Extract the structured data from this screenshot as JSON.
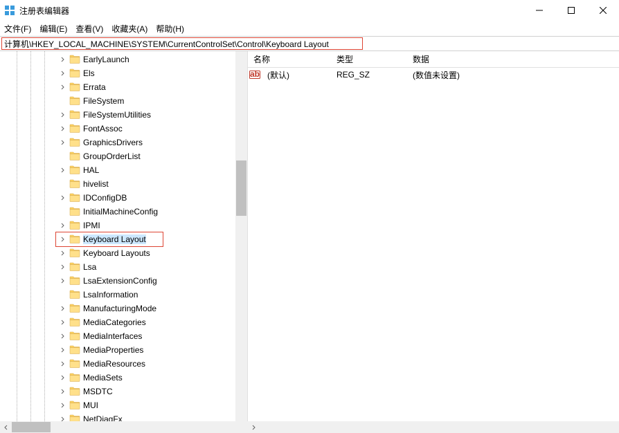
{
  "window": {
    "title": "注册表编辑器"
  },
  "menu": {
    "file": "文件(F)",
    "edit": "编辑(E)",
    "view": "查看(V)",
    "favorites": "收藏夹(A)",
    "help": "帮助(H)"
  },
  "address": {
    "path": "计算机\\HKEY_LOCAL_MACHINE\\SYSTEM\\CurrentControlSet\\Control\\Keyboard Layout"
  },
  "tree": {
    "items": [
      {
        "label": "EarlyLaunch",
        "expandable": true,
        "selected": false,
        "highlighted": false
      },
      {
        "label": "Els",
        "expandable": true,
        "selected": false,
        "highlighted": false
      },
      {
        "label": "Errata",
        "expandable": true,
        "selected": false,
        "highlighted": false
      },
      {
        "label": "FileSystem",
        "expandable": false,
        "selected": false,
        "highlighted": false
      },
      {
        "label": "FileSystemUtilities",
        "expandable": true,
        "selected": false,
        "highlighted": false
      },
      {
        "label": "FontAssoc",
        "expandable": true,
        "selected": false,
        "highlighted": false
      },
      {
        "label": "GraphicsDrivers",
        "expandable": true,
        "selected": false,
        "highlighted": false
      },
      {
        "label": "GroupOrderList",
        "expandable": false,
        "selected": false,
        "highlighted": false
      },
      {
        "label": "HAL",
        "expandable": true,
        "selected": false,
        "highlighted": false
      },
      {
        "label": "hivelist",
        "expandable": false,
        "selected": false,
        "highlighted": false
      },
      {
        "label": "IDConfigDB",
        "expandable": true,
        "selected": false,
        "highlighted": false
      },
      {
        "label": "InitialMachineConfig",
        "expandable": false,
        "selected": false,
        "highlighted": false
      },
      {
        "label": "IPMI",
        "expandable": true,
        "selected": false,
        "highlighted": false
      },
      {
        "label": "Keyboard Layout",
        "expandable": true,
        "selected": true,
        "highlighted": true
      },
      {
        "label": "Keyboard Layouts",
        "expandable": true,
        "selected": false,
        "highlighted": false
      },
      {
        "label": "Lsa",
        "expandable": true,
        "selected": false,
        "highlighted": false
      },
      {
        "label": "LsaExtensionConfig",
        "expandable": true,
        "selected": false,
        "highlighted": false
      },
      {
        "label": "LsaInformation",
        "expandable": false,
        "selected": false,
        "highlighted": false
      },
      {
        "label": "ManufacturingMode",
        "expandable": true,
        "selected": false,
        "highlighted": false
      },
      {
        "label": "MediaCategories",
        "expandable": true,
        "selected": false,
        "highlighted": false
      },
      {
        "label": "MediaInterfaces",
        "expandable": true,
        "selected": false,
        "highlighted": false
      },
      {
        "label": "MediaProperties",
        "expandable": true,
        "selected": false,
        "highlighted": false
      },
      {
        "label": "MediaResources",
        "expandable": true,
        "selected": false,
        "highlighted": false
      },
      {
        "label": "MediaSets",
        "expandable": true,
        "selected": false,
        "highlighted": false
      },
      {
        "label": "MSDTC",
        "expandable": true,
        "selected": false,
        "highlighted": false
      },
      {
        "label": "MUI",
        "expandable": true,
        "selected": false,
        "highlighted": false
      },
      {
        "label": "NetDiagFx",
        "expandable": true,
        "selected": false,
        "highlighted": false
      }
    ]
  },
  "list": {
    "headers": {
      "name": "名称",
      "type": "类型",
      "data": "数据"
    },
    "rows": [
      {
        "name": "(默认)",
        "type": "REG_SZ",
        "data": "(数值未设置)"
      }
    ]
  }
}
